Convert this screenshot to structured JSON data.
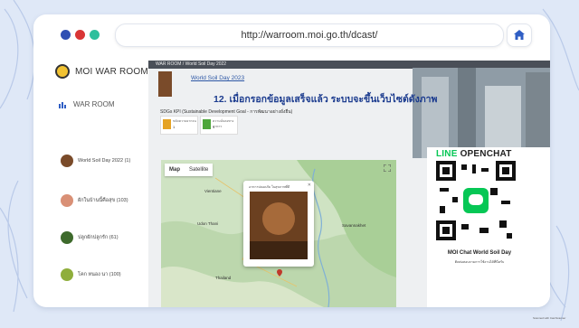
{
  "browser": {
    "window_dots": [
      "#2f4fb3",
      "#d93636",
      "#2fbf9d"
    ],
    "url": "http://warroom.moi.go.th/dcast/",
    "home_icon": "home-icon"
  },
  "sidebar": {
    "brand": "MOI WAR ROOM",
    "menu_label": "WAR ROOM",
    "items": [
      {
        "label": "World Soil Day 2022 (1)",
        "icon": "soil-thumb"
      },
      {
        "label": "ผักในบ้านนี้คือสุข (103)",
        "icon": "vegetable-thumb"
      },
      {
        "label": "ปลูกผักปลูกรัก (61)",
        "icon": "planting-thumb"
      },
      {
        "label": "โคก หนอง นา (100)",
        "icon": "farm-thumb"
      }
    ]
  },
  "content": {
    "breadcrumb": "WAR ROOM  /  World Soil Day 2022",
    "page_link": "World Soil Day 2023",
    "step_caption": "12. เมื่อกรอกข้อมูลเสร็จแล้ว ระบบจะขึ้นเว็บไซต์ดังภาพ",
    "kpi_caption": "SDGs KPI (Sustainable Development Goal - การพัฒนาอย่างยั่งยืน)",
    "kpi_cards": [
      {
        "title": "ขจัดความยากจน",
        "value": "1",
        "color": "#e5a323"
      },
      {
        "title": "ความมั่นคงทางอาหาร",
        "value": "1",
        "color": "#4ea63b"
      }
    ],
    "map": {
      "tabs": [
        "Map",
        "Satellite"
      ],
      "popup_caption": "อาหารปลอดภัย ในสุขภาพที่ดี",
      "popup_image_text": "World Soil Day",
      "labels": [
        "Vientiane",
        "Udon Thani",
        "Thailand",
        "Savannakhet"
      ]
    }
  },
  "line_panel": {
    "title_prefix": "LINE",
    "title_suffix": " OPENCHAT",
    "caption": "MOI Chat World Soil Day",
    "sub_caption": "ติดต่อสอบถามการใช้งานได้ที่นี่ครับ"
  },
  "credit": "Scanned with CamScanner"
}
